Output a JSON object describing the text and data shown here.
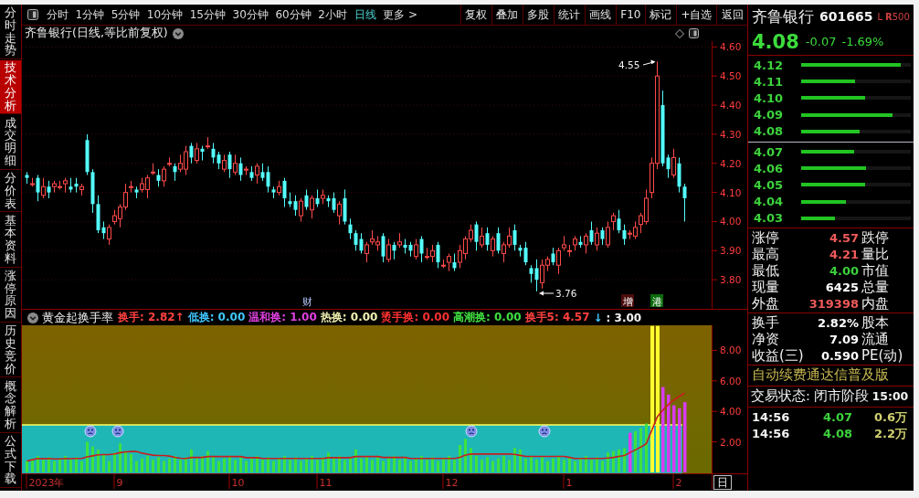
{
  "side_tabs": [
    {
      "label": "分时走势",
      "selected": false
    },
    {
      "label": "技术分析",
      "selected": true
    },
    {
      "label": "成交明细",
      "selected": false
    },
    {
      "label": "分价表",
      "selected": false
    },
    {
      "label": "基本资料",
      "selected": false
    },
    {
      "label": "涨停原因",
      "selected": false
    },
    {
      "label": "历史竞价",
      "selected": false
    },
    {
      "label": "概念解析",
      "selected": false
    },
    {
      "label": "公式下载",
      "selected": false
    }
  ],
  "toolbar": {
    "periods": [
      {
        "label": "分时",
        "selected": false
      },
      {
        "label": "1分钟",
        "selected": false
      },
      {
        "label": "5分钟",
        "selected": false
      },
      {
        "label": "10分钟",
        "selected": false
      },
      {
        "label": "15分钟",
        "selected": false
      },
      {
        "label": "30分钟",
        "selected": false
      },
      {
        "label": "60分钟",
        "selected": false
      },
      {
        "label": "2小时",
        "selected": false
      },
      {
        "label": "日线",
        "selected": true
      }
    ],
    "more": "更多 >",
    "buttons": [
      "复权",
      "叠加",
      "多股",
      "统计",
      "画线",
      "F10",
      "标记",
      "+自选",
      "返回"
    ]
  },
  "chart": {
    "title": "齐鲁银行(日线,等比前复权)",
    "chart_data": {
      "type": "candlestick",
      "grid": true,
      "ohlc": [
        [
          4.16,
          4.17,
          4.13,
          4.15
        ],
        [
          4.13,
          4.15,
          4.12,
          4.13
        ],
        [
          4.15,
          4.16,
          4.07,
          4.1
        ],
        [
          4.09,
          4.15,
          4.08,
          4.12
        ],
        [
          4.12,
          4.14,
          4.08,
          4.1
        ],
        [
          4.12,
          4.14,
          4.1,
          4.13
        ],
        [
          4.12,
          4.14,
          4.11,
          4.12
        ],
        [
          4.13,
          4.15,
          4.1,
          4.14
        ],
        [
          4.12,
          4.15,
          4.1,
          4.11
        ],
        [
          4.13,
          4.15,
          4.1,
          4.12
        ],
        [
          4.11,
          4.13,
          4.09,
          4.12
        ],
        [
          4.28,
          4.3,
          4.16,
          4.17
        ],
        [
          4.17,
          4.18,
          4.03,
          4.06
        ],
        [
          4.06,
          4.09,
          3.96,
          3.97
        ],
        [
          3.98,
          4.0,
          3.94,
          3.96
        ],
        [
          3.94,
          3.99,
          3.92,
          3.98
        ],
        [
          4.0,
          4.04,
          3.99,
          4.02
        ],
        [
          4.01,
          4.06,
          3.98,
          4.05
        ],
        [
          4.05,
          4.13,
          4.04,
          4.1
        ],
        [
          4.12,
          4.14,
          4.1,
          4.12
        ],
        [
          4.11,
          4.12,
          4.08,
          4.1
        ],
        [
          4.11,
          4.15,
          4.1,
          4.13
        ],
        [
          4.11,
          4.16,
          4.08,
          4.15
        ],
        [
          4.17,
          4.2,
          4.16,
          4.17
        ],
        [
          4.16,
          4.18,
          4.12,
          4.14
        ],
        [
          4.14,
          4.19,
          4.12,
          4.18
        ],
        [
          4.2,
          4.22,
          4.19,
          4.2
        ],
        [
          4.19,
          4.2,
          4.14,
          4.17
        ],
        [
          4.18,
          4.23,
          4.17,
          4.2
        ],
        [
          4.18,
          4.26,
          4.16,
          4.24
        ],
        [
          4.26,
          4.27,
          4.2,
          4.22
        ],
        [
          4.21,
          4.27,
          4.2,
          4.25
        ],
        [
          4.25,
          4.26,
          4.21,
          4.24
        ],
        [
          4.26,
          4.29,
          4.25,
          4.26
        ],
        [
          4.25,
          4.27,
          4.2,
          4.22
        ],
        [
          4.23,
          4.24,
          4.18,
          4.2
        ],
        [
          4.18,
          4.23,
          4.17,
          4.21
        ],
        [
          4.23,
          4.24,
          4.15,
          4.18
        ],
        [
          4.17,
          4.23,
          4.16,
          4.2
        ],
        [
          4.2,
          4.22,
          4.14,
          4.16
        ],
        [
          4.18,
          4.19,
          4.16,
          4.18
        ],
        [
          4.17,
          4.19,
          4.14,
          4.15
        ],
        [
          4.16,
          4.2,
          4.13,
          4.19
        ],
        [
          4.17,
          4.2,
          4.14,
          4.15
        ],
        [
          4.17,
          4.19,
          4.1,
          4.12
        ],
        [
          4.11,
          4.12,
          4.08,
          4.1
        ],
        [
          4.1,
          4.14,
          4.09,
          4.12
        ],
        [
          4.14,
          4.15,
          4.05,
          4.08
        ],
        [
          4.07,
          4.1,
          4.05,
          4.06
        ],
        [
          4.07,
          4.09,
          4.02,
          4.04
        ],
        [
          4.02,
          4.08,
          4.0,
          4.07
        ],
        [
          4.09,
          4.11,
          4.04,
          4.05
        ],
        [
          4.04,
          4.09,
          4.01,
          4.08
        ],
        [
          4.08,
          4.11,
          4.05,
          4.06
        ],
        [
          4.08,
          4.11,
          4.06,
          4.09
        ],
        [
          4.08,
          4.09,
          4.05,
          4.07
        ],
        [
          4.08,
          4.1,
          4.03,
          4.04
        ],
        [
          4.02,
          4.07,
          3.99,
          4.06
        ],
        [
          4.08,
          4.11,
          3.99,
          4.0
        ],
        [
          3.99,
          4.01,
          3.94,
          3.96
        ],
        [
          3.96,
          3.97,
          3.9,
          3.92
        ],
        [
          3.94,
          3.96,
          3.89,
          3.9
        ],
        [
          3.89,
          3.93,
          3.86,
          3.92
        ],
        [
          3.93,
          3.97,
          3.92,
          3.94
        ],
        [
          3.92,
          3.95,
          3.9,
          3.93
        ],
        [
          3.95,
          3.96,
          3.86,
          3.88
        ],
        [
          3.87,
          3.94,
          3.86,
          3.92
        ],
        [
          3.92,
          3.93,
          3.87,
          3.9
        ],
        [
          3.92,
          3.96,
          3.91,
          3.93
        ],
        [
          3.92,
          3.94,
          3.89,
          3.91
        ],
        [
          3.92,
          3.93,
          3.88,
          3.9
        ],
        [
          3.88,
          3.94,
          3.87,
          3.92
        ],
        [
          3.94,
          3.95,
          3.86,
          3.89
        ],
        [
          3.88,
          3.91,
          3.87,
          3.88
        ],
        [
          3.88,
          3.92,
          3.86,
          3.9
        ],
        [
          3.92,
          3.93,
          3.84,
          3.86
        ],
        [
          3.85,
          3.87,
          3.84,
          3.85
        ],
        [
          3.86,
          3.89,
          3.83,
          3.88
        ],
        [
          3.86,
          3.89,
          3.83,
          3.84
        ],
        [
          3.86,
          3.92,
          3.84,
          3.9
        ],
        [
          3.89,
          3.95,
          3.87,
          3.94
        ],
        [
          3.94,
          3.99,
          3.93,
          3.97
        ],
        [
          3.99,
          4.0,
          3.9,
          3.93
        ],
        [
          3.92,
          3.98,
          3.91,
          3.95
        ],
        [
          3.96,
          3.98,
          3.9,
          3.92
        ],
        [
          3.9,
          3.95,
          3.88,
          3.94
        ],
        [
          3.96,
          3.98,
          3.89,
          3.9
        ],
        [
          3.89,
          3.93,
          3.86,
          3.92
        ],
        [
          3.92,
          3.98,
          3.91,
          3.95
        ],
        [
          3.97,
          3.99,
          3.9,
          3.92
        ],
        [
          3.91,
          3.92,
          3.88,
          3.9
        ],
        [
          3.91,
          3.93,
          3.85,
          3.86
        ],
        [
          3.84,
          3.85,
          3.79,
          3.82
        ],
        [
          3.84,
          3.87,
          3.76,
          3.8
        ],
        [
          3.79,
          3.87,
          3.77,
          3.85
        ],
        [
          3.85,
          3.88,
          3.83,
          3.87
        ],
        [
          3.89,
          3.91,
          3.85,
          3.86
        ],
        [
          3.85,
          3.91,
          3.82,
          3.9
        ],
        [
          3.91,
          3.95,
          3.9,
          3.92
        ],
        [
          3.9,
          3.92,
          3.88,
          3.9
        ],
        [
          3.92,
          3.95,
          3.9,
          3.94
        ],
        [
          3.93,
          3.95,
          3.91,
          3.92
        ],
        [
          3.92,
          3.96,
          3.89,
          3.95
        ],
        [
          3.97,
          4.0,
          3.92,
          3.93
        ],
        [
          3.92,
          3.98,
          3.9,
          3.96
        ],
        [
          3.97,
          3.98,
          3.92,
          3.94
        ],
        [
          3.92,
          4.0,
          3.91,
          3.98
        ],
        [
          4.0,
          4.03,
          3.97,
          4.02
        ],
        [
          4.01,
          4.04,
          3.96,
          3.97
        ],
        [
          3.97,
          3.99,
          3.92,
          3.94
        ],
        [
          3.96,
          3.97,
          3.94,
          3.96
        ],
        [
          3.95,
          4.0,
          3.94,
          3.98
        ],
        [
          3.99,
          4.03,
          3.96,
          4.02
        ],
        [
          4.0,
          4.11,
          3.99,
          4.08
        ],
        [
          4.1,
          4.22,
          4.08,
          4.2
        ],
        [
          4.2,
          4.55,
          4.18,
          4.5
        ],
        [
          4.4,
          4.45,
          4.19,
          4.2
        ],
        [
          4.22,
          4.23,
          4.15,
          4.18
        ],
        [
          4.16,
          4.25,
          4.15,
          4.22
        ],
        [
          4.2,
          4.22,
          4.1,
          4.12
        ],
        [
          4.12,
          4.13,
          4.0,
          4.08
        ]
      ],
      "ylim": [
        3.7,
        4.62
      ],
      "yticks": [
        {
          "value": 4.6,
          "label": "4.60"
        },
        {
          "value": 4.5,
          "label": "4.50"
        },
        {
          "value": 4.4,
          "label": "4.40"
        },
        {
          "value": 4.3,
          "label": "4.30"
        },
        {
          "value": 4.2,
          "label": "4.20"
        },
        {
          "value": 4.1,
          "label": "4.10"
        },
        {
          "value": 4.0,
          "label": "4.00"
        },
        {
          "value": 3.9,
          "label": "3.90"
        },
        {
          "value": 3.8,
          "label": "3.80"
        }
      ]
    },
    "high_marker": "4.55",
    "low_marker": "3.76",
    "events": [
      {
        "text": "财",
        "kind": "finance"
      },
      {
        "text": "增",
        "kind": "increase"
      },
      {
        "text": "港",
        "kind": "connect"
      }
    ]
  },
  "indicator": {
    "name": "黄金起换手率",
    "legend": [
      {
        "text": "换手: 2.82↑",
        "color": "#ff4040"
      },
      {
        "text": "低换: 0.00",
        "color": "#40c8ff"
      },
      {
        "text": "温和换: 1.00",
        "color": "#e040e0"
      },
      {
        "text": "热换: 0.00",
        "color": "#f0f0b0"
      },
      {
        "text": "烫手换: 0.00",
        "color": "#ff3030"
      },
      {
        "text": "高潮换: 0.00",
        "color": "#40e040"
      },
      {
        "text": "换手5: 4.57",
        "color": "#ff4040"
      }
    ],
    "threshold": {
      "arrow": "↓",
      "value": ": 3.00"
    },
    "axis": [
      "8.00",
      "6.00",
      "4.00",
      "2.00"
    ]
  },
  "date_axis": {
    "labels": [
      "2023年",
      "9",
      "10",
      "11",
      "12",
      "1",
      "2"
    ],
    "period_button": "日"
  },
  "quote": {
    "name": "齐鲁银行",
    "code": "601665",
    "badges": [
      "L",
      "**R**500"
    ],
    "price": "4.08",
    "change": "-0.07",
    "change_pct": "-1.69%",
    "asks": [
      {
        "price": "4.12",
        "level": 0.91
      },
      {
        "price": "4.11",
        "level": 0.49
      },
      {
        "price": "4.10",
        "level": 0.58
      },
      {
        "price": "4.09",
        "level": 0.83
      },
      {
        "price": "4.08",
        "level": 0.53
      }
    ],
    "bids": [
      {
        "price": "4.07",
        "level": 0.48
      },
      {
        "price": "4.06",
        "level": 0.59
      },
      {
        "price": "4.05",
        "level": 0.58
      },
      {
        "price": "4.04",
        "level": 0.41
      },
      {
        "price": "4.03",
        "level": 0.31
      }
    ],
    "stats": [
      {
        "label": "涨停",
        "value": "4.57",
        "color": "#f05a5a",
        "label2": "跌停"
      },
      {
        "label": "最高",
        "value": "4.21",
        "color": "#f05a5a",
        "label2": "量比"
      },
      {
        "label": "最低",
        "value": "4.00",
        "color": "#3cd23c",
        "label2": "市值"
      },
      {
        "label": "现量",
        "value": "6425",
        "color": "#ffffff",
        "label2": "总量"
      },
      {
        "label": "外盘",
        "value": "319398",
        "color": "#f05a5a",
        "label2": "内盘"
      }
    ],
    "stats2": [
      {
        "label": "换手",
        "value": "2.82%",
        "label2": "股本"
      },
      {
        "label": "净资",
        "value": "7.09",
        "label2": "流通"
      },
      {
        "label": "收益(三)",
        "value": "0.590",
        "label2": "PE(动)"
      }
    ],
    "notice": "自动续费通达信普及版",
    "status": {
      "label": "交易状态: 闭市阶段",
      "time": "15:00"
    },
    "ticks": [
      {
        "time": "14:56",
        "price": "4.07",
        "volume": "0.6万"
      },
      {
        "time": "14:56",
        "price": "4.08",
        "volume": "2.2万"
      }
    ]
  }
}
